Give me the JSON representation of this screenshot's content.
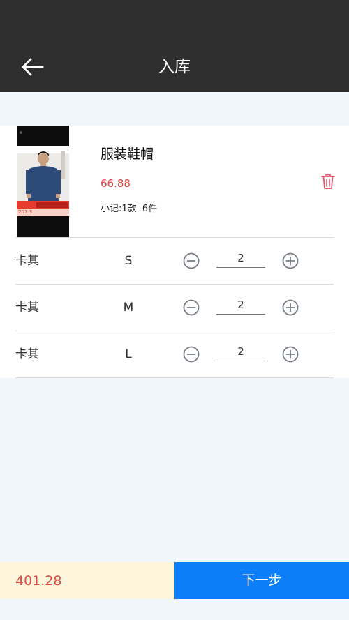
{
  "header": {
    "title": "入库",
    "back_icon": "arrow-left-icon"
  },
  "product": {
    "name": "服装鞋帽",
    "price": "66.88",
    "subtotal_label": "小记:1款",
    "subtotal_count": "6件",
    "delete_icon": "trash-icon",
    "image_price_tag": "201.3",
    "image_logo_text": "MOSS"
  },
  "variants": [
    {
      "color": "卡其",
      "size": "S",
      "qty": "2"
    },
    {
      "color": "卡其",
      "size": "M",
      "qty": "2"
    },
    {
      "color": "卡其",
      "size": "L",
      "qty": "2"
    }
  ],
  "footer": {
    "total": "401.28",
    "next_label": "下一步"
  },
  "colors": {
    "header_bg": "#2f2f2f",
    "price_red": "#e0483f",
    "trash_pink": "#e8546b",
    "primary_blue": "#0d7ef7",
    "total_bg": "#fdf6dc",
    "page_bg": "#f1f6fb"
  }
}
